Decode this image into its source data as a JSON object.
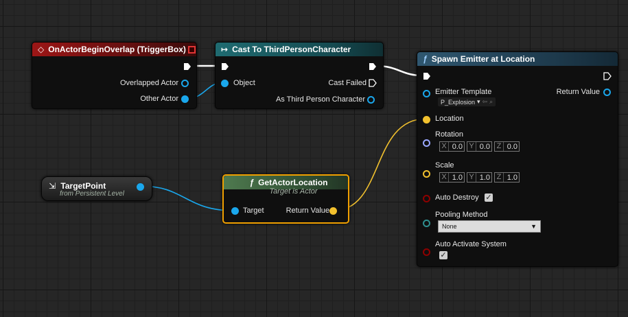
{
  "colors": {
    "exec": "#ffffff",
    "object": "#1aa7ec",
    "vector": "#f2c12e",
    "rotator": "#9aa8ff",
    "bool": "#8e0000",
    "byte": "#2f8f8f"
  },
  "event_node": {
    "title": "OnActorBeginOverlap (TriggerBox)",
    "pins": [
      "Overlapped Actor",
      "Other Actor"
    ]
  },
  "cast_node": {
    "title": "Cast To ThirdPersonCharacter",
    "pins": {
      "object": "Object",
      "cast_failed": "Cast Failed",
      "as_char": "As Third Person Character"
    }
  },
  "spawn_node": {
    "title": "Spawn Emitter at Location",
    "pins": {
      "emitter_template": "Emitter Template",
      "return_value": "Return Value",
      "location": "Location",
      "rotation": "Rotation",
      "scale": "Scale",
      "auto_destroy": "Auto Destroy",
      "pooling_method": "Pooling Method",
      "auto_activate": "Auto Activate System"
    },
    "emitter_value": "P_Explosion",
    "rotation": {
      "x": "0.0",
      "y": "0.0",
      "z": "0.0"
    },
    "scale": {
      "x": "1.0",
      "y": "1.0",
      "z": "1.0"
    },
    "axis": {
      "x": "X",
      "y": "Y",
      "z": "Z"
    },
    "auto_destroy_checked": true,
    "pooling_value": "None",
    "auto_activate_checked": true
  },
  "target_node": {
    "title": "TargetPoint",
    "subtitle": "from Persistent Level"
  },
  "getloc_node": {
    "title": "GetActorLocation",
    "subtitle": "Target is Actor",
    "pins": {
      "target": "Target",
      "return_value": "Return Value"
    }
  }
}
